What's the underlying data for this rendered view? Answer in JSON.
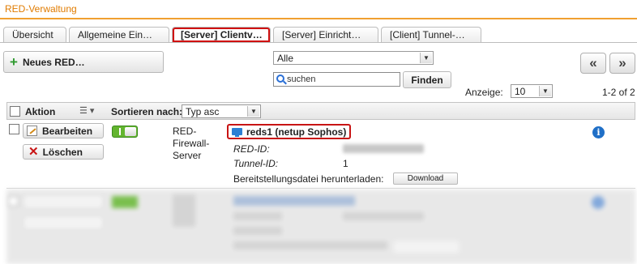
{
  "header": {
    "title": "RED-Verwaltung"
  },
  "tabs": [
    {
      "label": "Übersicht"
    },
    {
      "label": "Allgemeine Ein…"
    },
    {
      "label": "[Server] Clientv…"
    },
    {
      "label": "[Server] Einricht…"
    },
    {
      "label": "[Client] Tunnel-…"
    }
  ],
  "toolbar": {
    "new_button": "Neues RED…",
    "filter_select": "Alle",
    "search_placeholder": "suchen",
    "find_button": "Finden",
    "prev_icon": "«",
    "next_icon": "»",
    "display_label": "Anzeige:",
    "display_value": "10",
    "page_info": "1-2 of 2"
  },
  "table_header": {
    "action": "Aktion",
    "sort_label": "Sortieren nach:",
    "sort_value": "Typ asc"
  },
  "rows": [
    {
      "edit_button": "Bearbeiten",
      "delete_button": "Löschen",
      "enabled": true,
      "type": "RED-\nFirewall-\nServer",
      "name": "reds1 (netup Sophos)",
      "red_id_label": "RED-ID:",
      "tunnel_id_label": "Tunnel-ID:",
      "tunnel_id": "1",
      "download_label": "Bereitstellungsdatei herunterladen:",
      "download_button": "Download"
    }
  ],
  "colors": {
    "accent": "#e07b00",
    "highlight": "#d01010",
    "toggle": "#63b52f",
    "info": "#1f6fc7"
  },
  "icons": [
    "plus-icon",
    "search-icon",
    "edit-icon",
    "delete-icon",
    "monitor-icon",
    "info-icon",
    "list-icon"
  ]
}
